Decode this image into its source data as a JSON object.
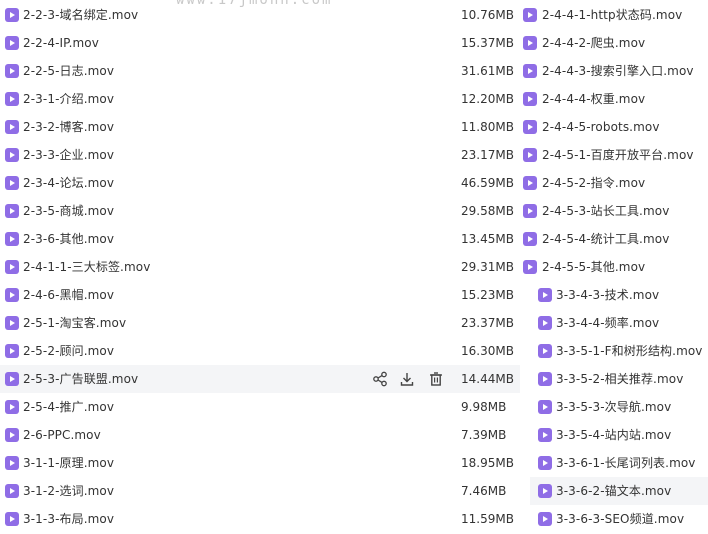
{
  "watermark": "www.17jmohn.com",
  "left_files": [
    {
      "name": "2-2-3-域名绑定.mov",
      "size": "10.76MB"
    },
    {
      "name": "2-2-4-IP.mov",
      "size": "15.37MB"
    },
    {
      "name": "2-2-5-日志.mov",
      "size": "31.61MB"
    },
    {
      "name": "2-3-1-介绍.mov",
      "size": "12.20MB"
    },
    {
      "name": "2-3-2-博客.mov",
      "size": "11.80MB"
    },
    {
      "name": "2-3-3-企业.mov",
      "size": "23.17MB"
    },
    {
      "name": "2-3-4-论坛.mov",
      "size": "46.59MB"
    },
    {
      "name": "2-3-5-商城.mov",
      "size": "29.58MB"
    },
    {
      "name": "2-3-6-其他.mov",
      "size": "13.45MB"
    },
    {
      "name": "2-4-1-1-三大标签.mov",
      "size": "29.31MB"
    },
    {
      "name": "2-4-6-黑帽.mov",
      "size": "15.23MB"
    },
    {
      "name": "2-5-1-淘宝客.mov",
      "size": "23.37MB"
    },
    {
      "name": "2-5-2-顾问.mov",
      "size": "16.30MB"
    },
    {
      "name": "2-5-3-广告联盟.mov",
      "size": "14.44MB",
      "hovered": true
    },
    {
      "name": "2-5-4-推广.mov",
      "size": "9.98MB"
    },
    {
      "name": "2-6-PPC.mov",
      "size": "7.39MB"
    },
    {
      "name": "3-1-1-原理.mov",
      "size": "18.95MB"
    },
    {
      "name": "3-1-2-选词.mov",
      "size": "7.46MB"
    },
    {
      "name": "3-1-3-布局.mov",
      "size": "11.59MB"
    }
  ],
  "right_files": [
    {
      "name": "2-4-4-1-http状态码.mov"
    },
    {
      "name": "2-4-4-2-爬虫.mov"
    },
    {
      "name": "2-4-4-3-搜索引擎入口.mov"
    },
    {
      "name": "2-4-4-4-权重.mov"
    },
    {
      "name": "2-4-4-5-robots.mov"
    },
    {
      "name": "2-4-5-1-百度开放平台.mov"
    },
    {
      "name": "2-4-5-2-指令.mov"
    },
    {
      "name": "2-4-5-3-站长工具.mov"
    },
    {
      "name": "2-4-5-4-统计工具.mov"
    },
    {
      "name": "2-4-5-5-其他.mov"
    },
    {
      "name": "3-3-4-3-技术.mov"
    },
    {
      "name": "3-3-4-4-频率.mov"
    },
    {
      "name": "3-3-5-1-F和树形结构.mov"
    },
    {
      "name": "3-3-5-2-相关推荐.mov"
    },
    {
      "name": "3-3-5-3-次导航.mov"
    },
    {
      "name": "3-3-5-4-站内站.mov"
    },
    {
      "name": "3-3-6-1-长尾词列表.mov"
    },
    {
      "name": "3-3-6-2-锚文本.mov",
      "hovered": true
    },
    {
      "name": "3-3-6-3-SEO频道.mov"
    }
  ],
  "hover_actions": [
    {
      "icon": "share-icon"
    },
    {
      "icon": "download-icon"
    },
    {
      "icon": "delete-icon"
    }
  ],
  "colors": {
    "video_icon": "#8f6de6",
    "hover_row": "#f4f5f7",
    "text": "#333333"
  }
}
